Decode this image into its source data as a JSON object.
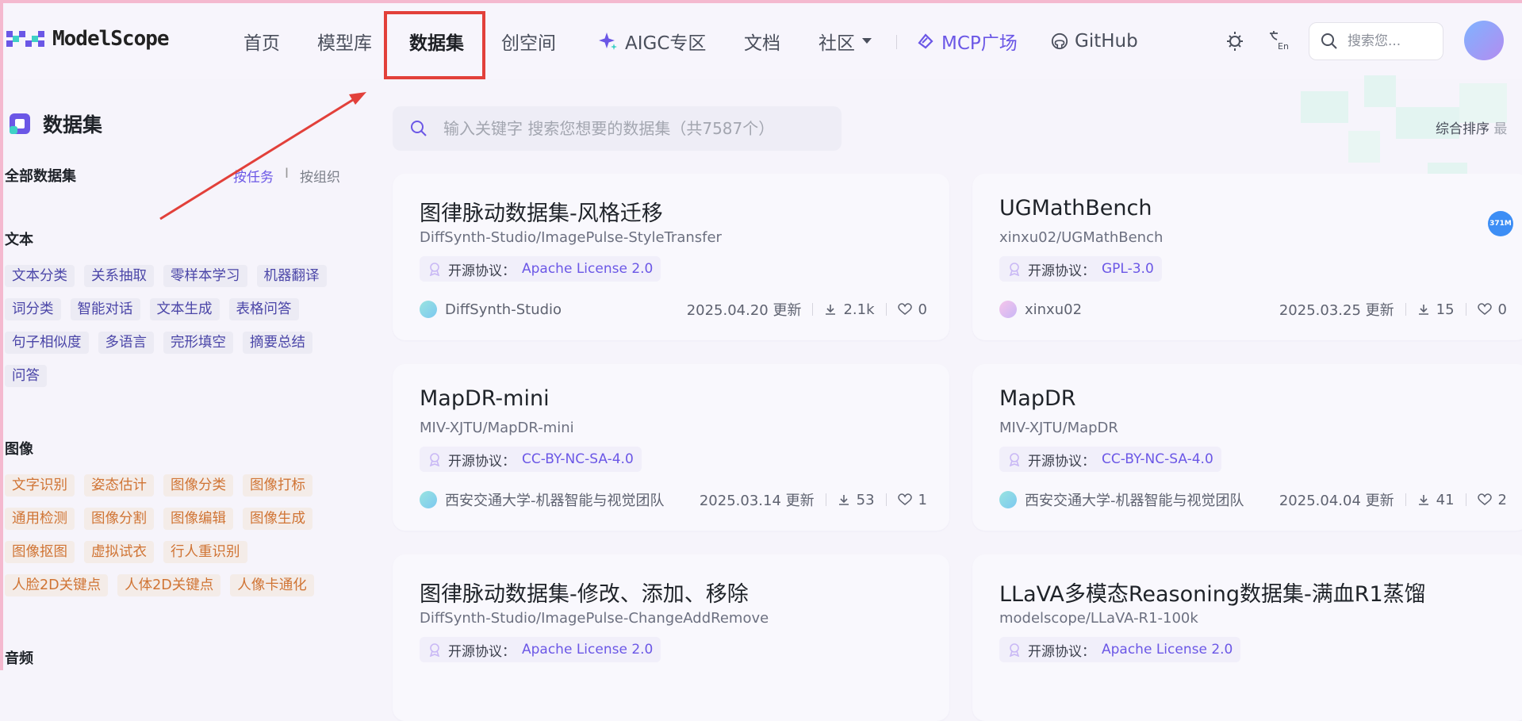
{
  "brand": {
    "name": "ModelScope"
  },
  "nav": {
    "home": "首页",
    "models": "模型库",
    "datasets": "数据集",
    "studios": "创空间",
    "aigc": "AIGC专区",
    "docs": "文档",
    "community": "社区",
    "mcp": "MCP广场",
    "github": "GitHub"
  },
  "top_search": {
    "placeholder": "搜索您..."
  },
  "sidebar": {
    "title": "数据集",
    "all_label": "全部数据集",
    "sort_by_task": "按任务",
    "sort_sep": "I",
    "sort_by_org": "按组织",
    "groups": [
      {
        "title": "文本",
        "tags": [
          "文本分类",
          "关系抽取",
          "零样本学习",
          "机器翻译",
          "词分类",
          "智能对话",
          "文本生成",
          "表格问答",
          "句子相似度",
          "多语言",
          "完形填空",
          "摘要总结",
          "问答"
        ]
      },
      {
        "title": "图像",
        "tags": [
          "文字识别",
          "姿态估计",
          "图像分类",
          "图像打标",
          "通用检测",
          "图像分割",
          "图像编辑",
          "图像生成",
          "图像抠图",
          "虚拟试衣",
          "行人重识别",
          "人脸2D关键点",
          "人体2D关键点",
          "人像卡通化"
        ]
      },
      {
        "title": "音频",
        "tags": []
      }
    ]
  },
  "main": {
    "search_placeholder": "输入关键字 搜索您想要的数据集（共7587个）",
    "sort_label": "综合排序",
    "sort_extra": "最",
    "license_key": "开源协议：",
    "updated_suffix": "更新",
    "cards": [
      {
        "title": "图律脉动数据集-风格迁移",
        "path": "DiffSynth-Studio/ImagePulse-StyleTransfer",
        "license": "Apache License 2.0",
        "owner": "DiffSynth-Studio",
        "date": "2025.04.20",
        "downloads": "2.1k",
        "likes": "0"
      },
      {
        "title": "UGMathBench",
        "path": "xinxu02/UGMathBench",
        "license": "GPL-3.0",
        "owner": "xinxu02",
        "date": "2025.03.25",
        "downloads": "15",
        "likes": "0"
      },
      {
        "title": "MapDR-mini",
        "path": "MIV-XJTU/MapDR-mini",
        "license": "CC-BY-NC-SA-4.0",
        "owner": "西安交通大学-机器智能与视觉团队",
        "date": "2025.03.14",
        "downloads": "53",
        "likes": "1"
      },
      {
        "title": "MapDR",
        "path": "MIV-XJTU/MapDR",
        "license": "CC-BY-NC-SA-4.0",
        "owner": "西安交通大学-机器智能与视觉团队",
        "date": "2025.04.04",
        "downloads": "41",
        "likes": "2"
      },
      {
        "title": "图律脉动数据集-修改、添加、移除",
        "path": "DiffSynth-Studio/ImagePulse-ChangeAddRemove",
        "license": "Apache License 2.0"
      },
      {
        "title": "LLaVA多模态Reasoning数据集-满血R1蒸馏",
        "path": "modelscope/LLaVA-R1-100k",
        "license": "Apache License 2.0"
      }
    ]
  },
  "floating_badge": "371M",
  "colors": {
    "accent": "#6b57e6",
    "highlight": "#e2403a",
    "badge": "#3d8ef5"
  }
}
